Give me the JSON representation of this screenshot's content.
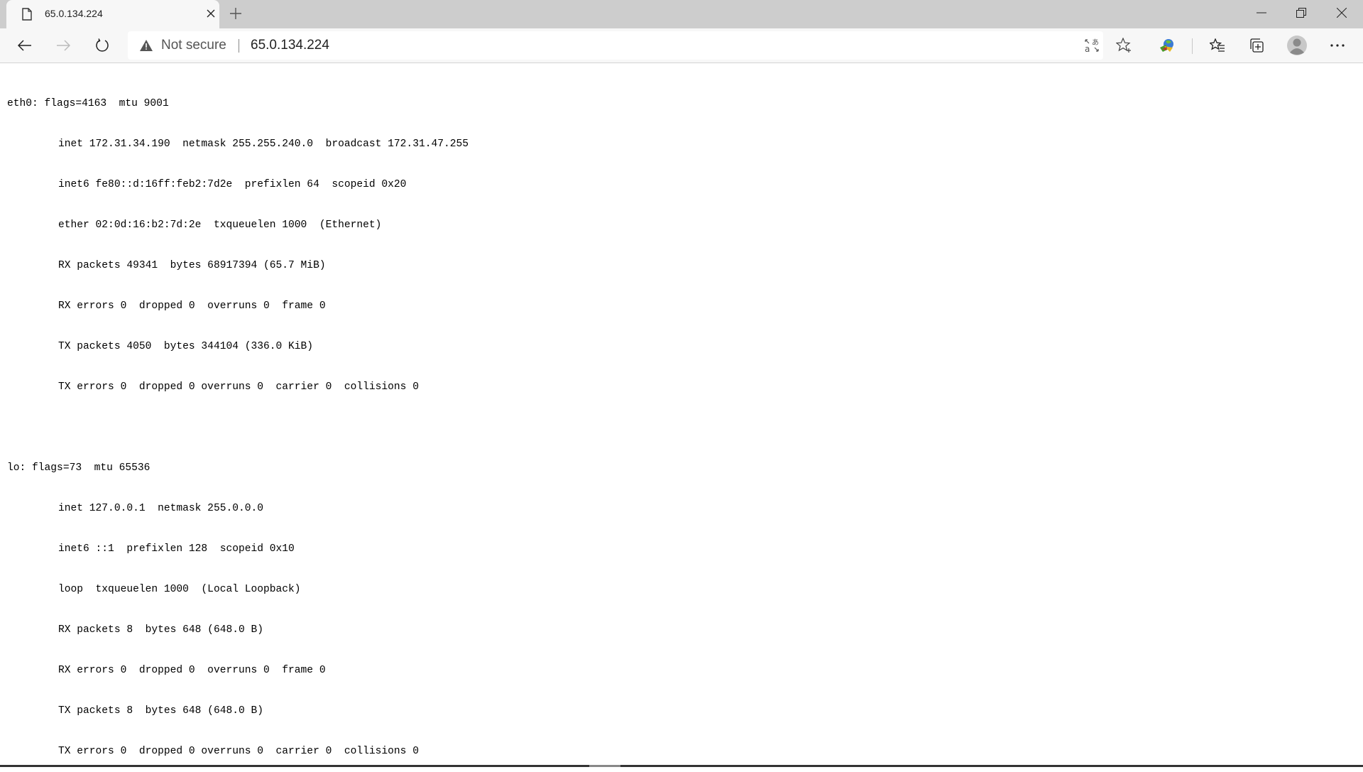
{
  "browser": {
    "tab": {
      "title": "65.0.134.224",
      "icon": "page-icon",
      "close_icon": "close-icon"
    },
    "new_tab_icon": "plus-icon",
    "window_controls": [
      "minimize-icon",
      "restore-icon",
      "close-icon"
    ],
    "toolbar": {
      "back_icon": "back-arrow-icon",
      "forward_icon": "forward-arrow-icon",
      "refresh_icon": "refresh-icon",
      "security_label": "Not secure",
      "security_icon": "warning-icon",
      "url": "65.0.134.224",
      "right_icons": [
        "translate-icon",
        "favorite-star-icon",
        "extension-icon",
        "favorites-list-icon",
        "collections-icon",
        "profile-avatar-icon",
        "more-menu-icon"
      ]
    }
  },
  "page": {
    "interfaces": [
      {
        "header": "eth0: flags=4163  mtu 9001",
        "lines": [
          "inet 172.31.34.190  netmask 255.255.240.0  broadcast 172.31.47.255",
          "inet6 fe80::d:16ff:feb2:7d2e  prefixlen 64  scopeid 0x20",
          "ether 02:0d:16:b2:7d:2e  txqueuelen 1000  (Ethernet)",
          "RX packets 49341  bytes 68917394 (65.7 MiB)",
          "RX errors 0  dropped 0  overruns 0  frame 0",
          "TX packets 4050  bytes 344104 (336.0 KiB)",
          "TX errors 0  dropped 0 overruns 0  carrier 0  collisions 0"
        ]
      },
      {
        "header": "lo: flags=73  mtu 65536",
        "lines": [
          "inet 127.0.0.1  netmask 255.0.0.0",
          "inet6 ::1  prefixlen 128  scopeid 0x10",
          "loop  txqueuelen 1000  (Local Loopback)",
          "RX packets 8  bytes 648 (648.0 B)",
          "RX errors 0  dropped 0  overruns 0  frame 0",
          "TX packets 8  bytes 648 (648.0 B)",
          "TX errors 0  dropped 0 overruns 0  carrier 0  collisions 0"
        ]
      }
    ]
  }
}
